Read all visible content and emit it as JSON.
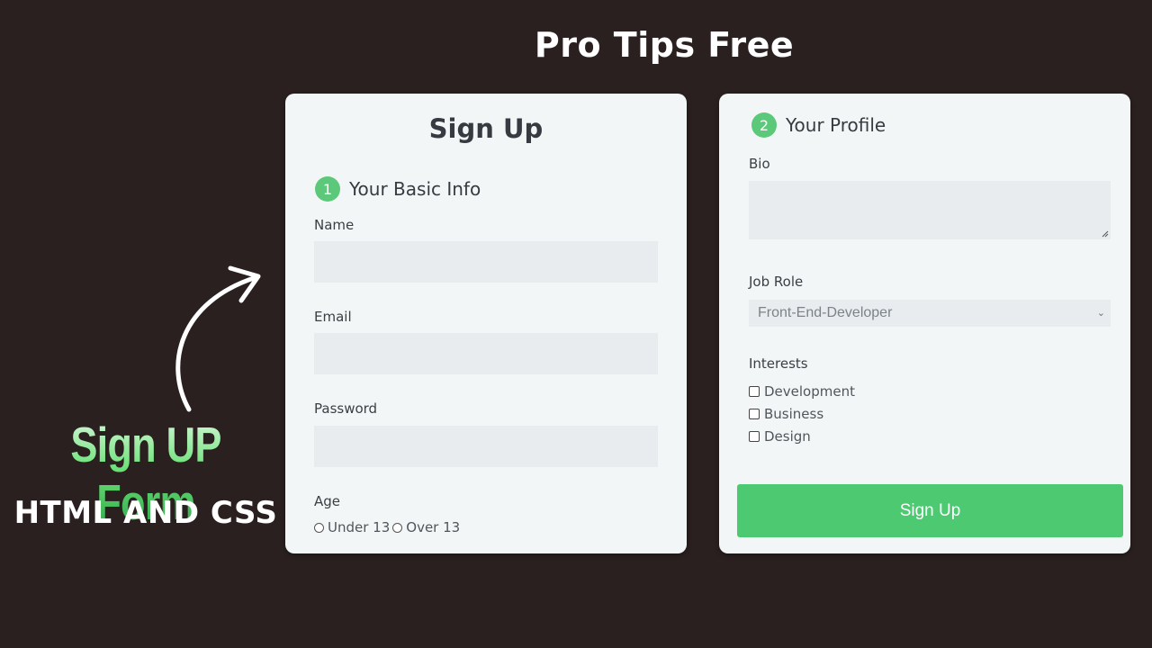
{
  "header": {
    "title": "Pro Tips Free"
  },
  "promo": {
    "title": "Sign UP Form",
    "subtitle": "HTML AND CSS",
    "arrow_icon": "curved-arrow-icon"
  },
  "colors": {
    "background": "#2a2020",
    "card": "#f2f6f6",
    "accent": "#4cc971",
    "badge": "#5cc87a",
    "input": "#e8ecee"
  },
  "left_card": {
    "heading": "Sign Up",
    "section": {
      "number": "1",
      "title": "Your Basic Info"
    },
    "fields": {
      "name": {
        "label": "Name",
        "value": ""
      },
      "email": {
        "label": "Email",
        "value": ""
      },
      "password": {
        "label": "Password",
        "value": ""
      }
    },
    "age": {
      "label": "Age",
      "options": [
        "Under 13",
        "Over 13"
      ]
    }
  },
  "right_card": {
    "section": {
      "number": "2",
      "title": "Your Profile"
    },
    "bio": {
      "label": "Bio",
      "value": ""
    },
    "job_role": {
      "label": "Job Role",
      "selected": "Front-End-Developer"
    },
    "interests": {
      "label": "Interests",
      "options": [
        "Development",
        "Business",
        "Design"
      ]
    },
    "submit_label": "Sign Up"
  }
}
